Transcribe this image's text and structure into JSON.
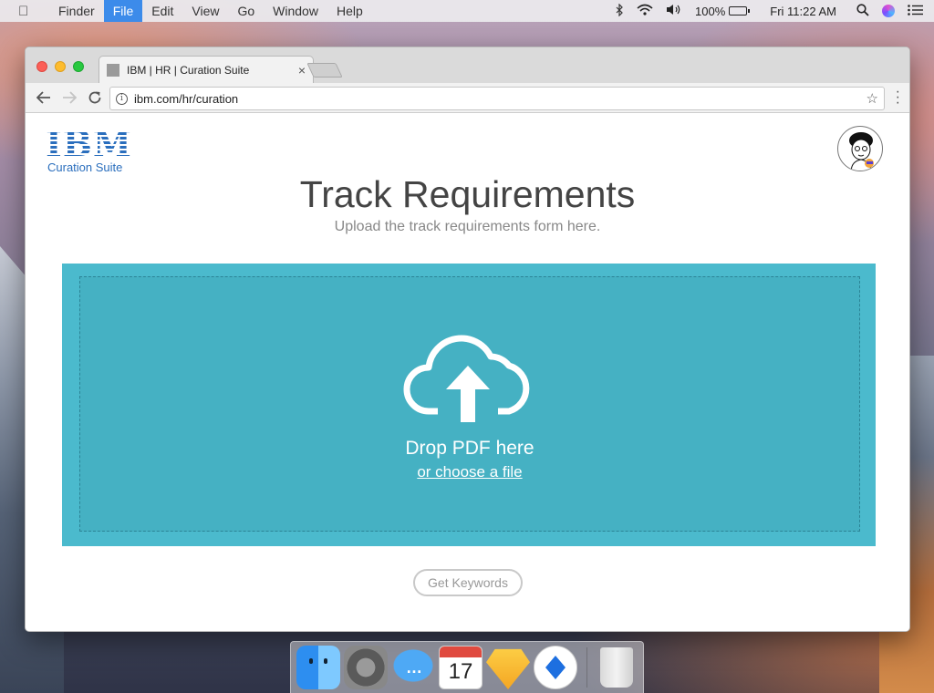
{
  "menubar": {
    "items": [
      "Finder",
      "File",
      "Edit",
      "View",
      "Go",
      "Window",
      "Help"
    ],
    "active_item": "File",
    "battery": "100%",
    "clock": "Fri 11:22 AM"
  },
  "browser": {
    "tab_title": "IBM | HR | Curation Suite",
    "url": "ibm.com/hr/curation"
  },
  "page": {
    "logo_text": "IBM",
    "logo_subtitle": "Curation Suite",
    "title": "Track Requirements",
    "subtitle": "Upload the track requirements form here.",
    "drop_text": "Drop PDF here",
    "choose_link": "or choose a file",
    "keywords_button": "Get Keywords"
  },
  "dock": {
    "calendar_day": "17",
    "apps": [
      "finder",
      "system-preferences",
      "messages",
      "calendar",
      "sketch",
      "pinwheel-app",
      "trash"
    ]
  },
  "colors": {
    "menu_highlight": "#3c8bea",
    "dropzone": "#4bbacd",
    "brand_blue": "#2a6ebd"
  }
}
